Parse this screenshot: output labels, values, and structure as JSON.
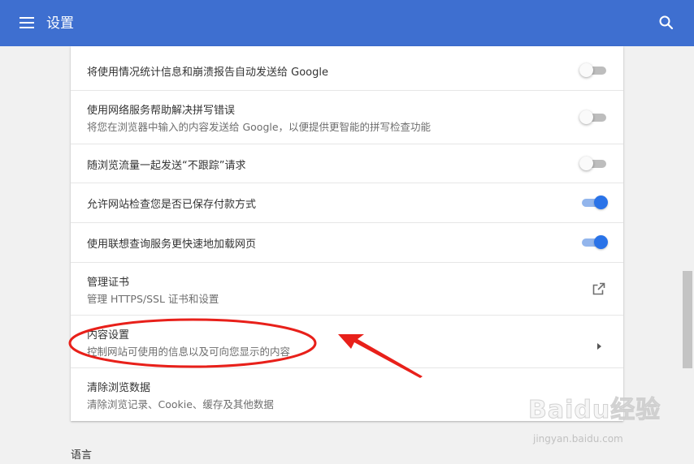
{
  "header": {
    "title": "设置",
    "bg_color": "#3e6fd0",
    "menu_icon": "hamburger-menu-icon",
    "search_icon": "search-icon"
  },
  "settings": {
    "rows": [
      {
        "title": "将使用情况统计信息和崩溃报告自动发送给 Google",
        "subtitle": "",
        "control": "toggle",
        "state": "off"
      },
      {
        "title": "使用网络服务帮助解决拼写错误",
        "subtitle": "将您在浏览器中输入的内容发送给 Google，以便提供更智能的拼写检查功能",
        "control": "toggle",
        "state": "off"
      },
      {
        "title": "随浏览流量一起发送“不跟踪”请求",
        "subtitle": "",
        "control": "toggle",
        "state": "off"
      },
      {
        "title": "允许网站检查您是否已保存付款方式",
        "subtitle": "",
        "control": "toggle",
        "state": "on"
      },
      {
        "title": "使用联想查询服务更快速地加载网页",
        "subtitle": "",
        "control": "toggle",
        "state": "on"
      },
      {
        "title": "管理证书",
        "subtitle": "管理 HTTPS/SSL 证书和设置",
        "control": "external-link-icon"
      },
      {
        "title": "内容设置",
        "subtitle": "控制网站可使用的信息以及可向您显示的内容",
        "control": "chevron-right-icon"
      },
      {
        "title": "清除浏览数据",
        "subtitle": "清除浏览记录、Cookie、缓存及其他数据",
        "control": "none"
      }
    ]
  },
  "section": {
    "label": "语言"
  },
  "annotation": {
    "color": "#e8201a",
    "shapes": [
      "ellipse",
      "arrow"
    ]
  },
  "watermark": {
    "brand": "Baidu经验",
    "url": "jingyan.baidu.com"
  },
  "colors": {
    "toggle_on": "#2a73e8",
    "toggle_on_track": "#92b5ec",
    "toggle_off_track": "#bdbdbd"
  }
}
